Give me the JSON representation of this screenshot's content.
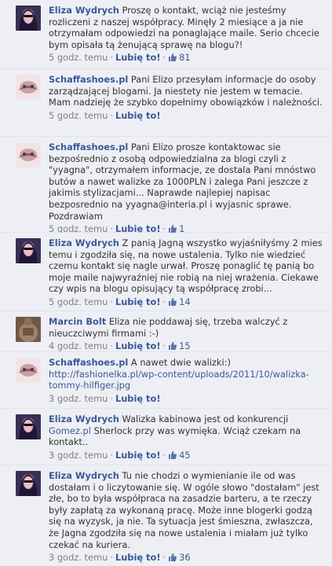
{
  "comments": [
    {
      "author": "Eliza Wydrych",
      "avatar": "eliza",
      "text": "Proszę o kontakt, wciąż nie jesteśmy rozliczeni z naszej współpracy. Minęły 2 miesiące a ja nie otrzymałam odpowiedzi na ponaglające maile. Serio chcecie bym opisała tą żenującą sprawę na blogu?!",
      "time": "5 godz. temu",
      "like_label": "Lubię to!",
      "likes": "81"
    },
    {
      "author": "Schaffashoes.pl",
      "avatar": "schaffa",
      "text": "Pani Elizo przesyłam informacje do osoby zarządzającej blogami. Ja niestety nie jestem w temacie. Mam nadzieję że szybko dopełnimy obowiązków i należności.",
      "time": "5 godz. temu",
      "like_label": "Lubię to!",
      "likes": ""
    },
    {
      "author": "Schaffashoes.pl",
      "avatar": "schaffa",
      "text": "Pani Elizo prosze kontaktowac sie bezpośrednio z osobą odpowiedzialna za blogi czyli z \"yyagna\", otrzymałem informacje, ze dostala Pani mnóstwo butów a nawet walizke za 1000PLN i zalega Pani jeszcze z jakimis stylizacjami... Naprawde najlepiej napisac bezposrednio na yyagna@interia.pl i wyjasnic sprawe. Pozdrawiam",
      "time": "5 godz. temu",
      "like_label": "Lubię to!",
      "likes": "1"
    },
    {
      "author": "Eliza Wydrych",
      "avatar": "eliza",
      "text": "Z panią Jagną wszystko wyjaśniłyśmy 2 mies temu i zgodziła się, na nowe ustalenia. Tylko nie wiedzieć czemu kontakt się nagle urwał. Proszę ponaglić tę panią bo moje maile najwyraźniej nie robią na niej wrażenia. Ciekawe czy wpis na blogu opisujący tą współpracę zrobi...",
      "time": "5 godz. temu",
      "like_label": "Lubię to!",
      "likes": "14"
    },
    {
      "author": "Marcin Bolt",
      "avatar": "marcin",
      "text": "Eliza nie poddawaj się, trzeba walczyć z nieuczciwymi firmami :-)",
      "time": "4 godz. temu",
      "like_label": "Lubię to!",
      "likes": "15"
    },
    {
      "author": "Schaffashoes.pl",
      "avatar": "schaffa",
      "text": "A nawet dwie walizki:)",
      "link": "http://fashionelka.pl/wp-content/uploads/2011/10/walizka-tommy-hilfiger.jpg",
      "time": "3 godz. temu",
      "like_label": "Lubię to!",
      "likes": ""
    },
    {
      "author": "Eliza Wydrych",
      "avatar": "eliza",
      "text_before": "Walizka kabinowa jest od konkurencji",
      "mention": "Gomez.pl",
      "text_after": "Sherlock przy was wymięka. Wciąż czekam na kontakt..",
      "time": "3 godz. temu",
      "like_label": "Lubię to!",
      "likes": "45"
    },
    {
      "author": "Eliza Wydrych",
      "avatar": "eliza",
      "text": "Tu nie chodzi o wymienianie ile od was dostałam i o liczytowanie się. W ogóle słowo \"dostałam\" jest złe, bo to była współpraca na zasadzie barteru, a te rzeczy były zapłatą za wykonaną pracę. Może inne blogerki godzą się na wyzysk, ja nie. Ta sytuacja jest śmieszna, zwłaszcza, że Jagna zgodziła się na nowe ustalenia i miałam już tylko czekać na kuriera.",
      "time": "3 godz. temu",
      "like_label": "Lubię to!",
      "likes": "36"
    }
  ],
  "icons": {
    "like": "thumbs-up-icon"
  }
}
